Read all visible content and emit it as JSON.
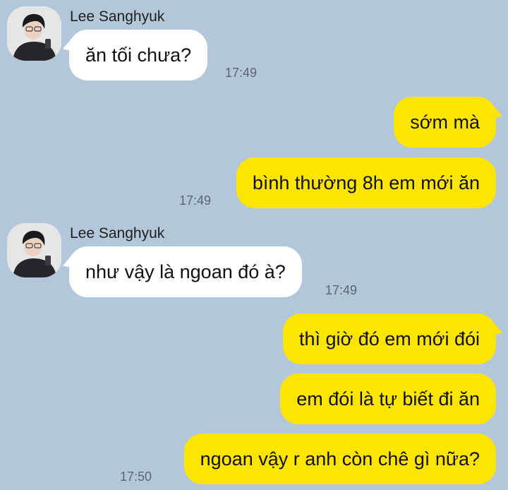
{
  "conversation": {
    "groups": [
      {
        "sender": "Lee Sanghyuk",
        "avatar_icon": "profile-photo",
        "messages": [
          {
            "text": "ăn tối chưa?",
            "time": "17:49"
          }
        ]
      },
      {
        "sender": "me",
        "messages": [
          {
            "text": "sớm mà"
          },
          {
            "text": "bình thường 8h em mới ăn",
            "time": "17:49"
          }
        ]
      },
      {
        "sender": "Lee Sanghyuk",
        "avatar_icon": "profile-photo",
        "messages": [
          {
            "text": "như vậy là ngoan đó à?",
            "time": "17:49"
          }
        ]
      },
      {
        "sender": "me",
        "messages": [
          {
            "text": "thì giờ đó em mới đói"
          },
          {
            "text": "em đói là tự biết đi ăn"
          },
          {
            "text": "ngoan vậy r anh còn chê gì nữa?",
            "time": "17:50"
          }
        ]
      }
    ]
  },
  "colors": {
    "background": "#b2c7da",
    "outgoing_bubble": "#fee500",
    "incoming_bubble": "#ffffff"
  }
}
